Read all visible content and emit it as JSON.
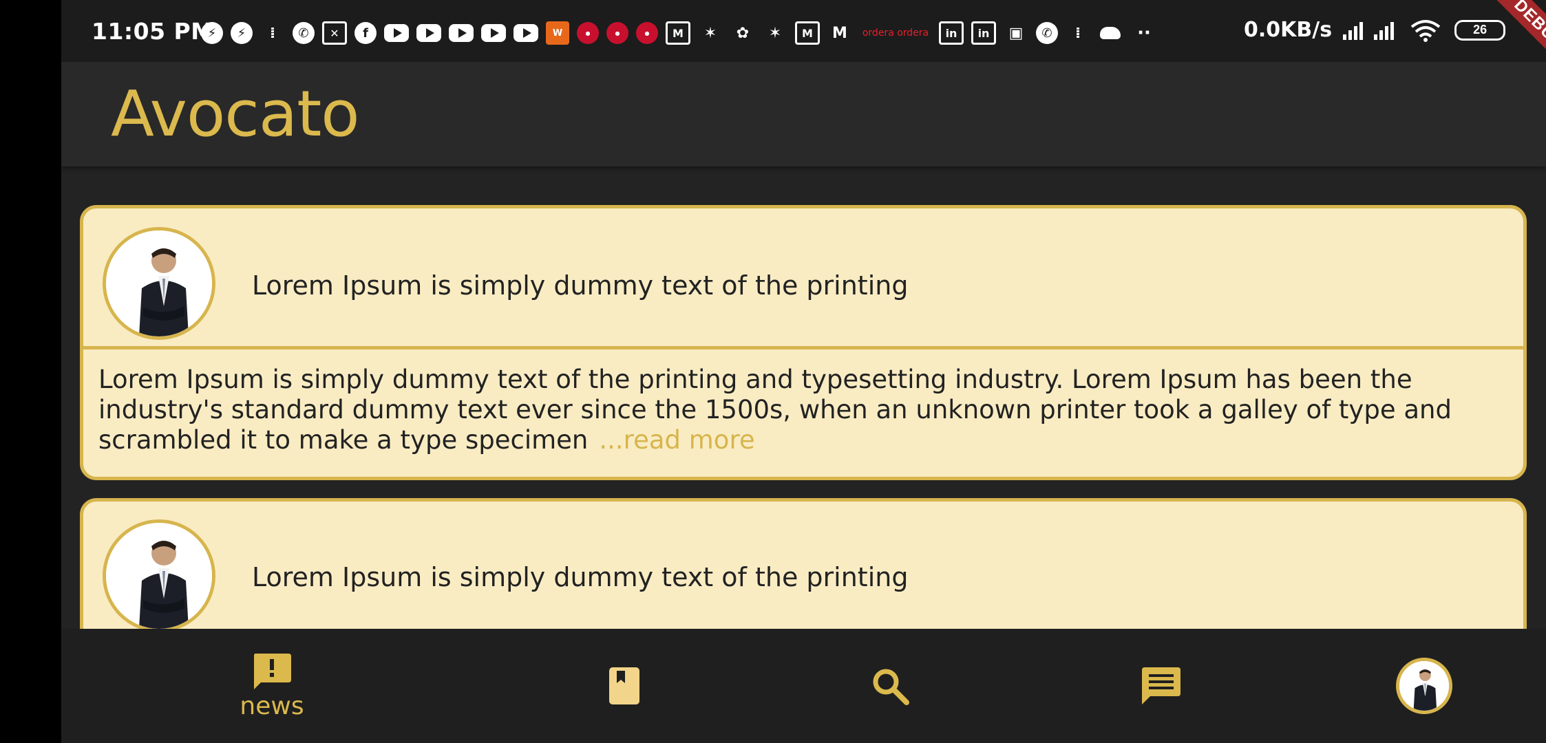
{
  "status_bar": {
    "time": "11:05 PM",
    "net_speed": "0.0KB/s",
    "battery": "26",
    "debug_label": "DEBUG",
    "notification_icons": [
      "messenger-icon",
      "messenger-icon",
      "footprints-icon",
      "phone-icon",
      "photos-icon",
      "facebook-icon",
      "youtube-icon",
      "youtube-icon",
      "youtube-icon",
      "youtube-icon",
      "youtube-icon",
      "app-orange-icon",
      "app-red-icon",
      "app-red-icon",
      "app-red-icon",
      "gmail-icon",
      "jump-icon",
      "flower-icon",
      "jump-icon",
      "gmail-icon",
      "mail-icon",
      "ordera-icon",
      "linkedin-icon",
      "linkedin-icon",
      "tv-icon",
      "whatsapp-icon",
      "footprints-icon",
      "cloud-icon",
      "more-dots-icon"
    ]
  },
  "app_bar": {
    "title": "Avocato"
  },
  "feed": {
    "cards": [
      {
        "title": "Lorem Ipsum is simply dummy text of the printing",
        "body": "Lorem Ipsum is simply dummy text of the printing and typesetting industry. Lorem Ipsum has been the industry's standard dummy text ever since the 1500s, when an unknown printer took a galley of type and scrambled it to make a type specimen",
        "read_more": "...read more"
      },
      {
        "title": "Lorem Ipsum is simply dummy text of the printing"
      }
    ]
  },
  "bottom_nav": {
    "items": [
      {
        "label": "news",
        "icon": "announcement-icon",
        "active": true
      },
      {
        "icon": "bookmark-icon"
      },
      {
        "icon": "search-icon"
      },
      {
        "icon": "chat-icon"
      },
      {
        "icon": "profile-avatar"
      }
    ]
  },
  "colors": {
    "accent": "#d7b54d",
    "card_bg": "#f9ecc3",
    "background": "#232323",
    "debug_ribbon": "#a4282a"
  }
}
